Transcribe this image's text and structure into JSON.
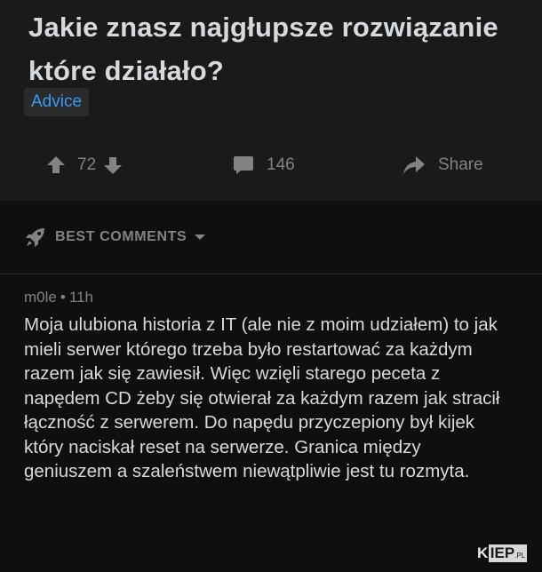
{
  "post": {
    "title": "Jakie znasz najgłupsze rozwiązanie które działało?",
    "flair": "Advice",
    "votes": "72",
    "comment_count": "146",
    "share_label": "Share",
    "icons": {
      "upvote": "arrow-up-icon",
      "downvote": "arrow-down-icon",
      "comments": "comment-bubble-icon",
      "share": "share-arrow-icon"
    }
  },
  "comments_bar": {
    "sort_label": "BEST COMMENTS",
    "icons": {
      "sort": "rocket-icon",
      "caret": "chevron-down-icon"
    }
  },
  "comment": {
    "author": "m0le",
    "separator": "•",
    "age": "11h",
    "body": "Moja ulubiona historia z IT (ale nie z moim udziałem) to jak mieli serwer którego trzeba było restartować za każdym razem jak się zawiesił. Więc wzięli starego peceta z napędem CD żeby się otwierał za każdym razem jak stracił łączność z serwerem. Do napędu przyczepiony był kijek który naciskał reset na serwerze. Granica między geniuszem a szaleństwem niewątpliwie jest tu rozmyta."
  },
  "watermark": {
    "letter": "K",
    "boxed": "IEP",
    "suffix": ".PL"
  },
  "colors": {
    "background": "#1a1a1b",
    "comment_background": "#0f0f10",
    "text": "#d7dadc",
    "muted": "#818384",
    "flair": "#3a9bf2"
  }
}
